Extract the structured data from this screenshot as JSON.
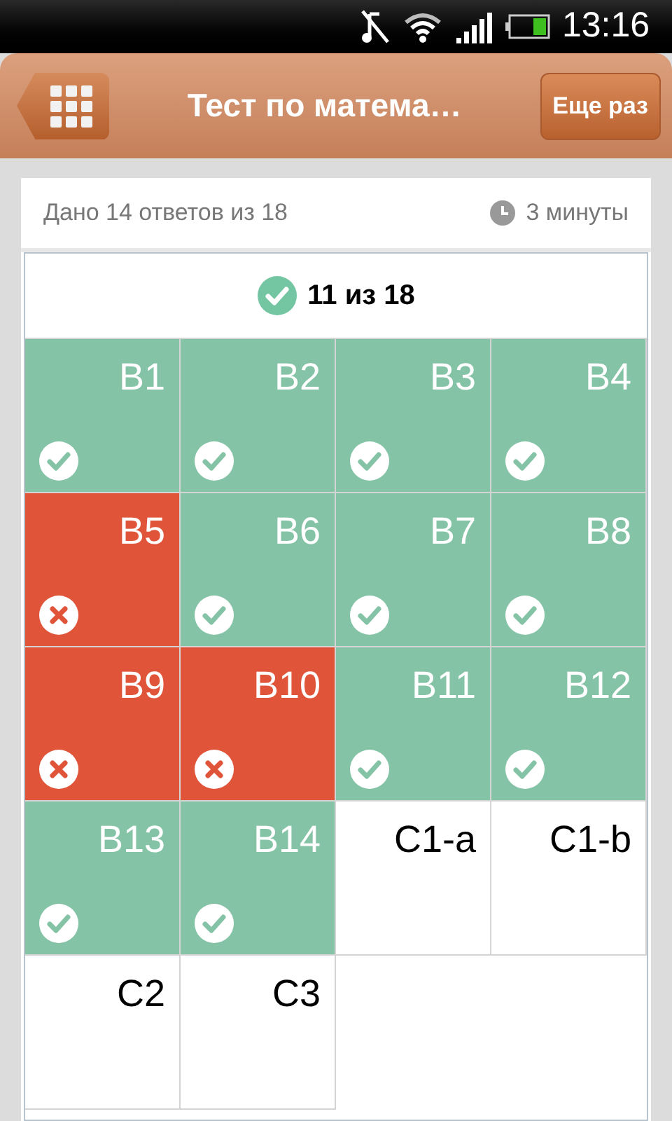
{
  "status_bar": {
    "time": "13:16"
  },
  "header": {
    "title": "Тест по матема…",
    "button": "Еще раз"
  },
  "summary": {
    "answered": "Дано 14 ответов из 18",
    "time": "3 минуты"
  },
  "score": "11 из 18",
  "cells": [
    {
      "label": "В1",
      "kind": "correct"
    },
    {
      "label": "В2",
      "kind": "correct"
    },
    {
      "label": "В3",
      "kind": "correct"
    },
    {
      "label": "В4",
      "kind": "correct"
    },
    {
      "label": "В5",
      "kind": "wrong"
    },
    {
      "label": "В6",
      "kind": "correct"
    },
    {
      "label": "В7",
      "kind": "correct"
    },
    {
      "label": "В8",
      "kind": "correct"
    },
    {
      "label": "В9",
      "kind": "wrong"
    },
    {
      "label": "В10",
      "kind": "wrong"
    },
    {
      "label": "В11",
      "kind": "correct"
    },
    {
      "label": "В12",
      "kind": "correct"
    },
    {
      "label": "В13",
      "kind": "correct"
    },
    {
      "label": "В14",
      "kind": "correct"
    },
    {
      "label": "С1-a",
      "kind": "unanswered"
    },
    {
      "label": "С1-b",
      "kind": "unanswered"
    },
    {
      "label": "С2",
      "kind": "unanswered"
    },
    {
      "label": "С3",
      "kind": "unanswered"
    }
  ]
}
